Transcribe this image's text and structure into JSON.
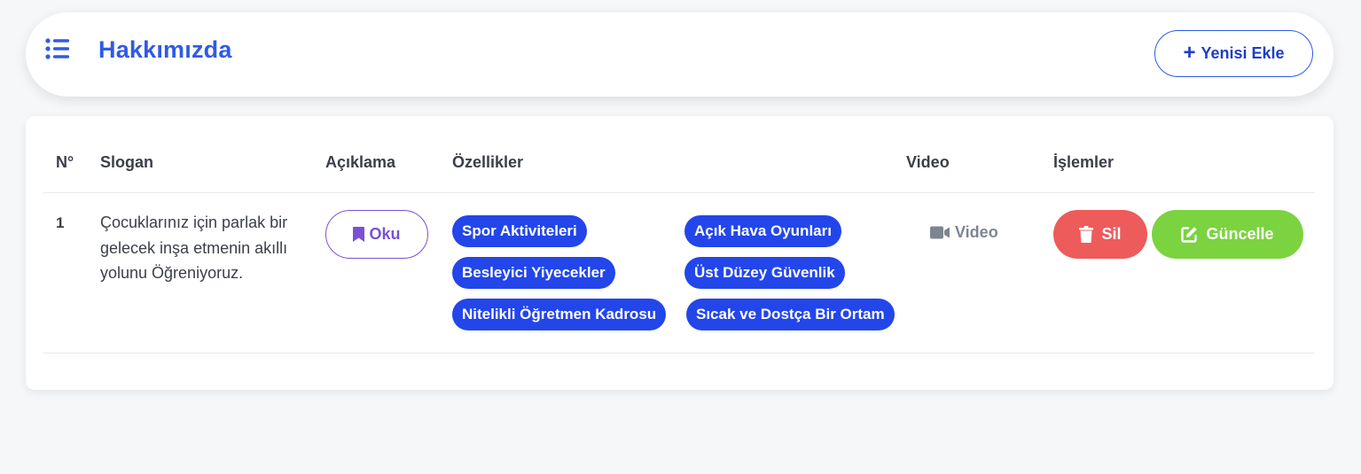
{
  "header": {
    "title": "Hakkımızda",
    "menu_icon": "list-icon",
    "add_button": {
      "icon": "plus-icon",
      "label": "Yenisi Ekle"
    }
  },
  "table": {
    "columns": [
      "N°",
      "Slogan",
      "Açıklama",
      "Özellikler",
      "Video",
      "İşlemler"
    ],
    "rows": [
      {
        "no": "1",
        "slogan": "Çocuklarınız için parlak bir gelecek inşa etmenin akıllı yolunu Öğreniyoruz.",
        "read_button": {
          "icon": "bookmark-icon",
          "label": "Oku"
        },
        "features": [
          "Spor Aktiviteleri",
          "Açık Hava Oyunları",
          "Besleyici Yiyecekler",
          "Üst Düzey Güvenlik",
          "Nitelikli Öğretmen Kadrosu",
          "Sıcak ve Dostça Bir Ortam"
        ],
        "video": {
          "icon": "video-camera-icon",
          "label": "Video"
        },
        "delete_button": {
          "icon": "trash-icon",
          "label": "Sil"
        },
        "update_button": {
          "icon": "edit-icon",
          "label": "Güncelle"
        }
      }
    ]
  },
  "colors": {
    "primary": "#2f5ae8",
    "tag": "#2346ea",
    "read": "#7b4fd6",
    "delete": "#ee5b5b",
    "update": "#7bd340",
    "background": "#f6f7f9"
  }
}
